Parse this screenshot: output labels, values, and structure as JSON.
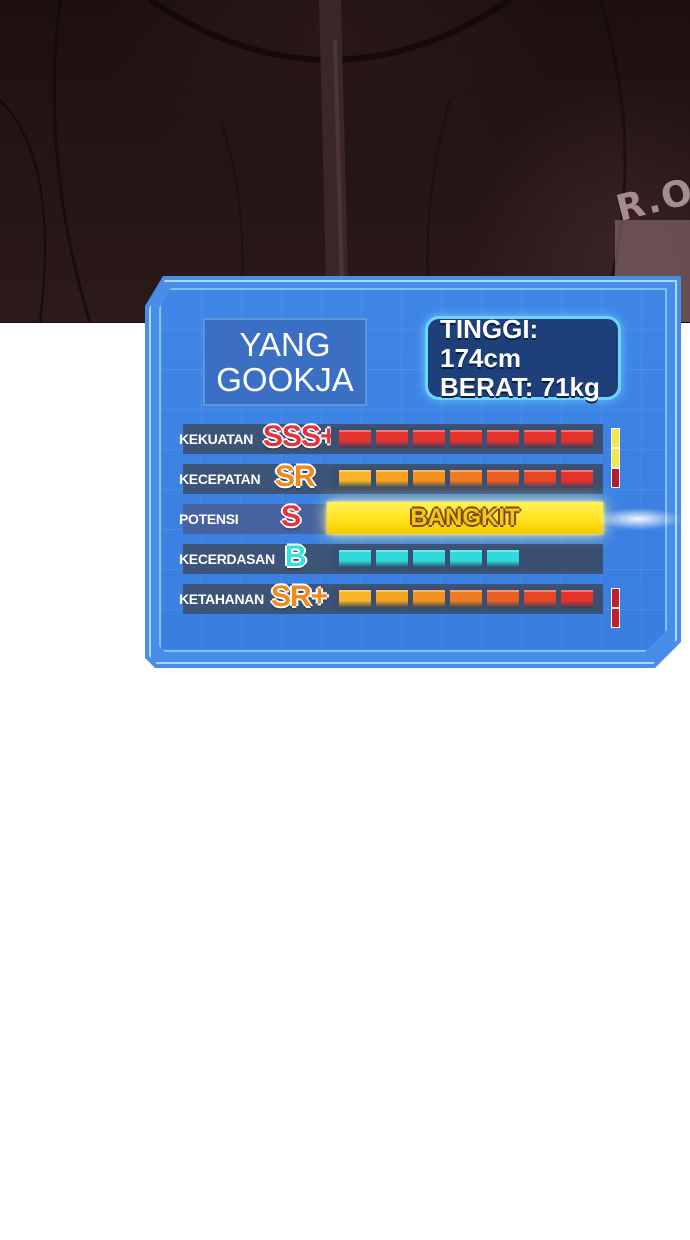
{
  "top_panel": {
    "badge_text": "R.O"
  },
  "card": {
    "name_line1": "YANG",
    "name_line2": "GOOKJA",
    "height_label": "TINGGI: 174cm",
    "weight_label": "BERAT: 71kg"
  },
  "stats": [
    {
      "label": "KEKUATAN",
      "rank": "SSS+",
      "rank_color": "#e8323a",
      "filled_segments": 7,
      "extra_marks": 3,
      "extra_color": "#f5e84a",
      "palette": "red"
    },
    {
      "label": "KECEPATAN",
      "rank": "SR",
      "rank_color": "#f08a1c",
      "filled_segments": 7,
      "extra_marks": 1,
      "extra_color": "#b0202a",
      "palette": "gradient"
    },
    {
      "label": "POTENSI",
      "rank": "S",
      "rank_color": "#e8323a",
      "bar_text": "BANGKIT",
      "palette": "awaken"
    },
    {
      "label": "KECERDASAN",
      "rank": "B",
      "rank_color": "#34e0e0",
      "filled_segments": 5,
      "extra_marks": 0,
      "palette": "cyan"
    },
    {
      "label": "KETAHANAN",
      "rank": "SR+",
      "rank_color": "#f08a1c",
      "filled_segments": 7,
      "extra_marks": 2,
      "extra_color": "#c02030",
      "palette": "gradient"
    }
  ],
  "colors": {
    "frame": "#4a8de8",
    "glow": "#5ab0ff",
    "red_seg": "#e8322e",
    "orange_seg": "#f39a1e",
    "cyan_seg": "#2fd9dd"
  }
}
